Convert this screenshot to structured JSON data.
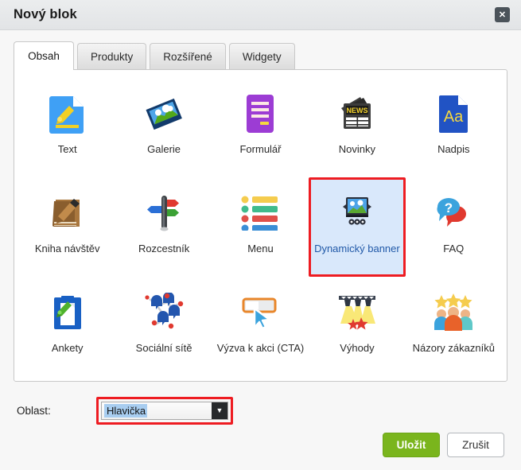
{
  "window": {
    "title": "Nový blok",
    "close_label": "✕"
  },
  "tabs": [
    {
      "label": "Obsah",
      "active": true
    },
    {
      "label": "Produkty",
      "active": false
    },
    {
      "label": "Rozšířené",
      "active": false
    },
    {
      "label": "Widgety",
      "active": false
    }
  ],
  "blocks": [
    {
      "label": "Text",
      "icon": "document-pencil-icon",
      "selected": false
    },
    {
      "label": "Galerie",
      "icon": "gallery-photo-icon",
      "selected": false
    },
    {
      "label": "Formulář",
      "icon": "form-icon",
      "selected": false
    },
    {
      "label": "Novinky",
      "icon": "newspaper-icon",
      "selected": false
    },
    {
      "label": "Nadpis",
      "icon": "heading-aa-icon",
      "selected": false
    },
    {
      "label": "Kniha návštěv",
      "icon": "guestbook-icon",
      "selected": false
    },
    {
      "label": "Rozcestník",
      "icon": "signpost-icon",
      "selected": false
    },
    {
      "label": "Menu",
      "icon": "menu-list-icon",
      "selected": false
    },
    {
      "label": "Dynamický banner",
      "icon": "dynamic-banner-icon",
      "selected": true
    },
    {
      "label": "FAQ",
      "icon": "speech-bubbles-question-icon",
      "selected": false
    },
    {
      "label": "Ankety",
      "icon": "clipboard-pencil-icon",
      "selected": false
    },
    {
      "label": "Sociální sítě",
      "icon": "social-network-icon",
      "selected": false
    },
    {
      "label": "Výzva k akci (CTA)",
      "icon": "cta-cursor-button-icon",
      "selected": false
    },
    {
      "label": "Výhody",
      "icon": "spotlight-stars-icon",
      "selected": false
    },
    {
      "label": "Názory zákazníků",
      "icon": "customer-reviews-icon",
      "selected": false
    }
  ],
  "area_field": {
    "label": "Oblast:",
    "value": "Hlavička"
  },
  "footer": {
    "save_label": "Uložit",
    "cancel_label": "Zrušit"
  },
  "colors": {
    "accent_red": "#ee1c22",
    "save_green": "#7ab51d",
    "selected_blue": "#d9e8fb",
    "selected_text": "#2159a8"
  }
}
